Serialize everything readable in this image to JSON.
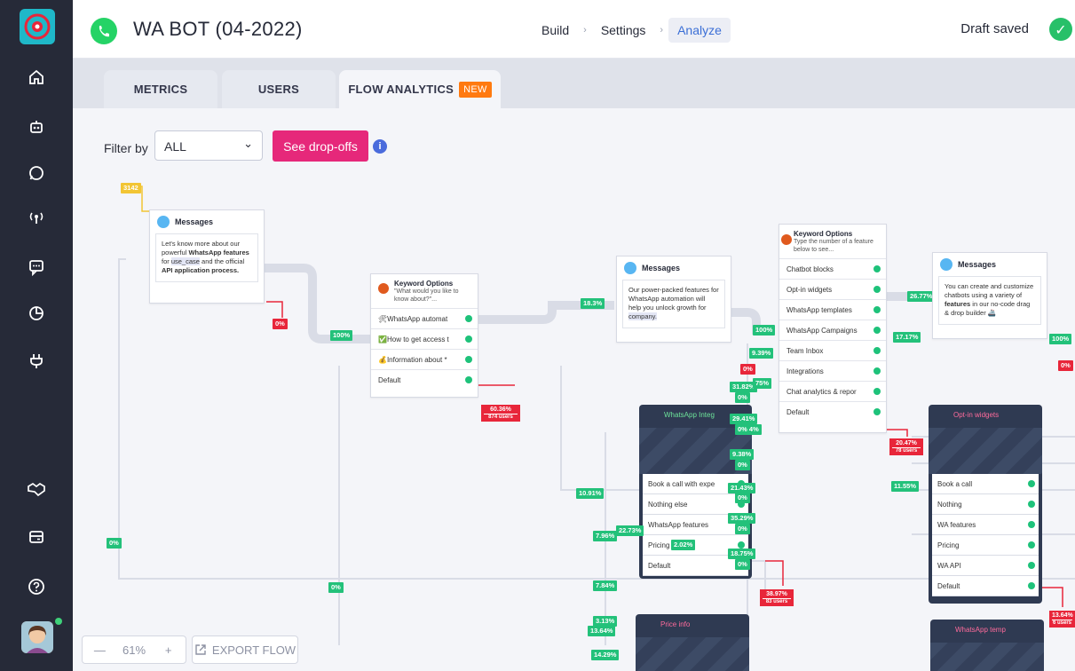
{
  "app": {
    "bot_title": "WA BOT (04-2022)",
    "draft_status": "Draft saved"
  },
  "breadcrumbs": [
    "Build",
    "Settings",
    "Analyze"
  ],
  "tabs": {
    "metrics": "METRICS",
    "users": "USERS",
    "flow_analytics": "FLOW ANALYTICS",
    "new_badge": "NEW"
  },
  "filter": {
    "label": "Filter by",
    "value": "ALL",
    "dropoffs_button": "See drop-offs",
    "info": "i"
  },
  "zoom": {
    "minus": "—",
    "level": "61%",
    "plus": "+",
    "export": "EXPORT FLOW"
  },
  "nodes": {
    "start_count": "3142",
    "messages1": {
      "title": "Messages",
      "text_a": "Let's know more about our powerful ",
      "bold_a": "WhatsApp features",
      "text_b": " for ",
      "code": "use_case",
      "text_c": " and the official ",
      "bold_b": "API application process."
    },
    "keyword1": {
      "title": "Keyword Options",
      "subtitle": "\"What would you like to know about?\"...",
      "options": [
        "🛠WhatsApp automat",
        "✅How to get access t",
        "💰Information about *",
        "Default"
      ]
    },
    "messages2": {
      "title": "Messages",
      "text": "Our power-packed features for WhatsApp automation will help you unlock growth for",
      "code": "company."
    },
    "keyword2": {
      "title": "Keyword Options",
      "subtitle": "Type the number of a feature below to see...",
      "options": [
        "Chatbot blocks",
        "Opt-in widgets",
        "WhatsApp templates",
        "WhatsApp Campaigns",
        "Team Inbox",
        "Integrations",
        "Chat analytics & repor",
        "Default"
      ]
    },
    "messages3": {
      "title": "Messages",
      "text_a": "You can create and customize chatbots using a variety of ",
      "bold": "features",
      "text_b": " in our no-code drag & drop builder 🚢"
    },
    "wa_integ": {
      "title": "WhatsApp Integ",
      "options": [
        "Book a call with expe",
        "Nothing else",
        "WhatsApp features",
        "Pricing",
        "Default"
      ]
    },
    "optin": {
      "title": "Opt-in widgets",
      "options": [
        "Book a call",
        "Nothing",
        "WA features",
        "Pricing",
        "WA API",
        "Default"
      ]
    },
    "price_info": {
      "title": "Price info"
    },
    "wa_temp": {
      "title": "WhatsApp temp"
    }
  },
  "percents": {
    "p0a": "0%",
    "p100a": "100%",
    "p0b": "0%",
    "p0c": "0%",
    "p183": "18.3%",
    "p100b": "100%",
    "p939": "9.39%",
    "p0d": "0%",
    "p3182": "31.82%",
    "p075": "75%",
    "p0e": "0%",
    "p2941": "29.41%",
    "p0f": "0% 4%",
    "p938": "9.38%",
    "p0g": "0%",
    "p2143": "21.43%",
    "p0h": "0%",
    "p3529": "35.29%",
    "p0i": "0%",
    "p1875": "18.75%",
    "p0j": "0%",
    "p202": "2.02%",
    "p1091": "10.91%",
    "p796": "7.96%",
    "p2273": "22.73%",
    "p784": "7.84%",
    "p313": "3.13%",
    "p1364": "13.64%",
    "p1429": "14.29%",
    "p2677": "26.77%",
    "p1717": "17.17%",
    "p1155": "11.55%",
    "p100c": "100%",
    "p0k": "0%",
    "drop1": "60.36%",
    "drop1u": "874 users",
    "drop2": "20.47%",
    "drop2u": "78 users",
    "drop3": "38.97%",
    "drop3u": "83 users",
    "drop4": "13.64%",
    "drop4u": "6 users"
  },
  "sidebar_icons": [
    "home-icon",
    "bot-icon",
    "whatsapp-icon",
    "broadcast-icon",
    "chat-icon",
    "analytics-icon",
    "integrations-icon",
    "handshake-icon",
    "billing-icon",
    "help-icon"
  ],
  "colors": {
    "sidebar": "#262a38",
    "accent_green": "#23c17a",
    "dropoff_red": "#e8263a",
    "cta_pink": "#e6287a",
    "new_orange": "#ff7a10"
  }
}
